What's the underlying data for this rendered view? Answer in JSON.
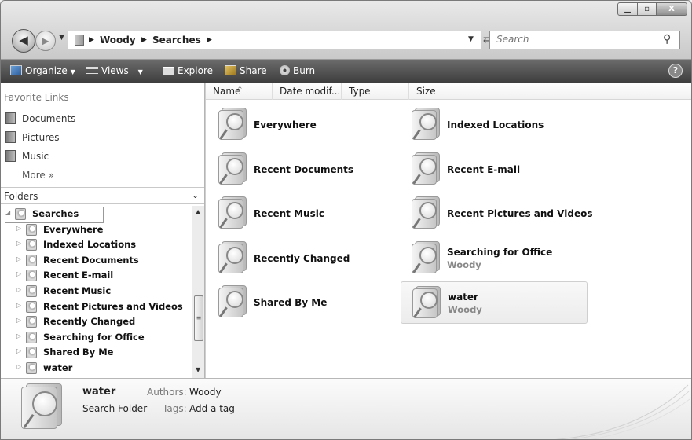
{
  "window": {
    "controls": {
      "minimize": "▁",
      "maximize": "▫",
      "close": "X"
    }
  },
  "nav": {
    "back_glyph": "◀",
    "forward_glyph": "▶",
    "history_glyph": "▼",
    "address": {
      "crumbs": [
        "Woody",
        "Searches"
      ],
      "separator": "▶",
      "dropdown_glyph": "▼"
    },
    "refresh_glyph": "⇄",
    "search_placeholder": "Search"
  },
  "toolbar": {
    "organize": "Organize",
    "views": "Views",
    "explore": "Explore",
    "share": "Share",
    "burn": "Burn",
    "help": "?"
  },
  "navpane": {
    "favorites_header": "Favorite Links",
    "favorites": [
      "Documents",
      "Pictures",
      "Music"
    ],
    "more": "More  »",
    "folders_header": "Folders",
    "folders_chevron": "⌄",
    "tree": [
      {
        "label": "Searches",
        "expander": "◢",
        "root": true
      },
      {
        "label": "Everywhere",
        "expander": "▷"
      },
      {
        "label": "Indexed Locations",
        "expander": "▷"
      },
      {
        "label": "Recent Documents",
        "expander": "▷"
      },
      {
        "label": "Recent E-mail",
        "expander": "▷"
      },
      {
        "label": "Recent Music",
        "expander": "▷"
      },
      {
        "label": "Recent Pictures and Videos",
        "expander": "▷"
      },
      {
        "label": "Recently Changed",
        "expander": "▷"
      },
      {
        "label": "Searching for Office",
        "expander": "▷"
      },
      {
        "label": "Shared By Me",
        "expander": "▷"
      },
      {
        "label": "water",
        "expander": "▷"
      }
    ],
    "scroll": {
      "up": "▲",
      "down": "▼",
      "grip": "≡"
    }
  },
  "columns": [
    "Name",
    "Date modif...",
    "Type",
    "Size"
  ],
  "sort_indicator": "^",
  "items": [
    {
      "name": "Everywhere",
      "author": ""
    },
    {
      "name": "Indexed Locations",
      "author": ""
    },
    {
      "name": "Recent Documents",
      "author": ""
    },
    {
      "name": "Recent E-mail",
      "author": ""
    },
    {
      "name": "Recent Music",
      "author": ""
    },
    {
      "name": "Recent Pictures and Videos",
      "author": ""
    },
    {
      "name": "Recently Changed",
      "author": ""
    },
    {
      "name": "Searching for Office",
      "author": "Woody"
    },
    {
      "name": "Shared By Me",
      "author": ""
    },
    {
      "name": "water",
      "author": "Woody",
      "selected": true
    }
  ],
  "details": {
    "name": "water",
    "type": "Search Folder",
    "authors_label": "Authors:",
    "authors": "Woody",
    "tags_label": "Tags:",
    "tags": "Add a tag"
  },
  "colors": {
    "toolbar": "#4f4f4f",
    "selection": "#ececec"
  }
}
